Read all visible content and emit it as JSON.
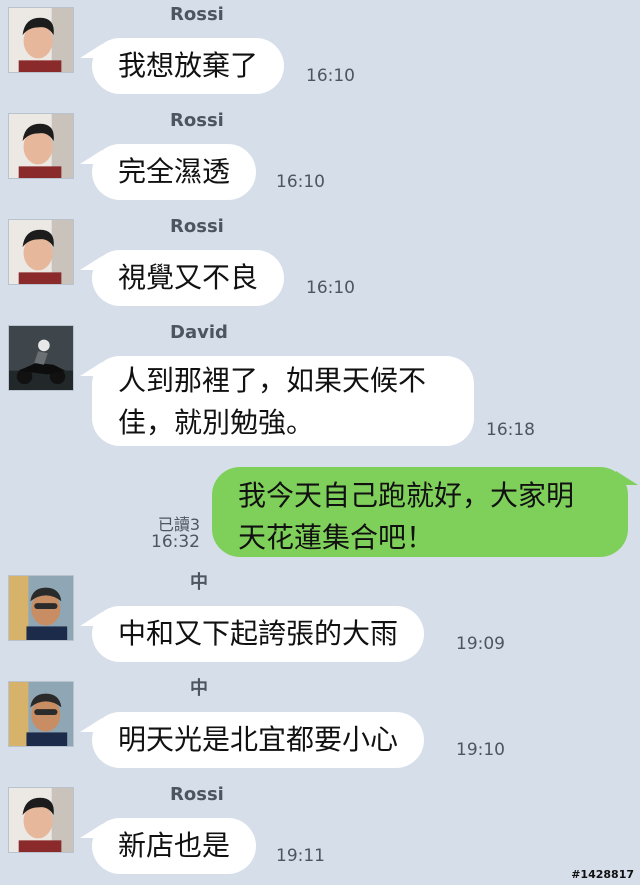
{
  "messages": [
    {
      "sender": "Rossi",
      "text": "我想放棄了",
      "time": "16:10",
      "avatar": "avatar-rossi"
    },
    {
      "sender": "Rossi",
      "text": "完全濕透",
      "time": "16:10",
      "avatar": "avatar-rossi"
    },
    {
      "sender": "Rossi",
      "text": "視覺又不良",
      "time": "16:10",
      "avatar": "avatar-rossi"
    },
    {
      "sender": "David",
      "text_line1": "人到那裡了，如果天候不",
      "text_line2": "佳，就別勉強。",
      "time": "16:18",
      "avatar": "avatar-david-motorcycle"
    },
    {
      "sender": "me",
      "text_line1": "我今天自己跑就好，大家明",
      "text_line2": "天花蓮集合吧！",
      "read": "已讀3",
      "time": "16:32"
    },
    {
      "sender": "中",
      "text": "中和又下起誇張的大雨",
      "time": "19:09",
      "avatar": "avatar-zhong-sunglasses"
    },
    {
      "sender": "中",
      "text": "明天光是北宜都要小心",
      "time": "19:10",
      "avatar": "avatar-zhong-sunglasses"
    },
    {
      "sender": "Rossi",
      "text": "新店也是",
      "time": "19:11",
      "avatar": "avatar-rossi"
    }
  ],
  "watermark": "#1428817",
  "colors": {
    "background": "#d6dee9",
    "incoming_bubble": "#ffffff",
    "outgoing_bubble": "#7fd05b"
  }
}
